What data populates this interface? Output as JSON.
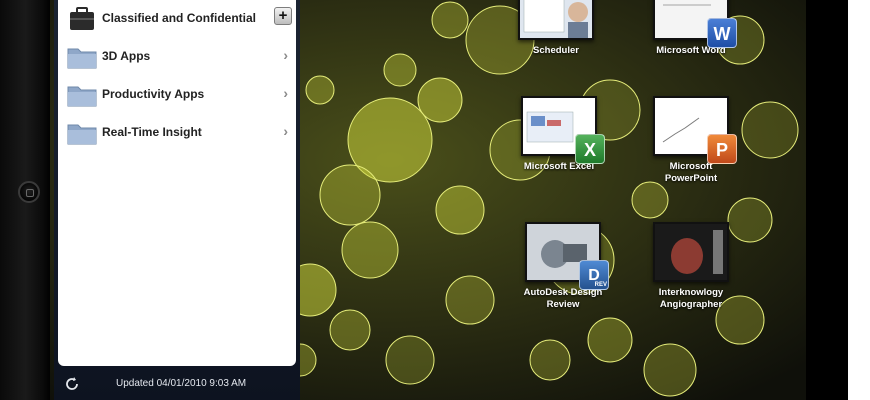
{
  "sidebar": {
    "items": [
      {
        "label": "Classified and Confidential",
        "icon": "briefcase-icon",
        "action": "+"
      },
      {
        "label": "3D Apps",
        "icon": "folder-icon",
        "action": "›"
      },
      {
        "label": "Productivity Apps",
        "icon": "folder-icon",
        "action": "›"
      },
      {
        "label": "Real-Time Insight",
        "icon": "folder-icon",
        "action": "›"
      }
    ],
    "footer": {
      "updated": "Updated 04/01/2010 9:03 AM"
    }
  },
  "apps": [
    {
      "label": "Scheduler"
    },
    {
      "label": "Microsoft Word",
      "badge": "W"
    },
    {
      "label": "Microsoft Excel",
      "badge": "X"
    },
    {
      "label_line1": "Microsoft",
      "label_line2": "PowerPoint",
      "badge": "P"
    },
    {
      "label_line1": "AutoDesk Design",
      "label_line2": "Review",
      "badge": "D",
      "badge_sub": "REV"
    },
    {
      "label_line1": "Interknowlogy",
      "label_line2": "Angiographer"
    }
  ],
  "colors": {
    "panel_bg": "#1b2433",
    "wallpaper_base": "#2d2f16",
    "bokeh": "#c8d23a"
  }
}
